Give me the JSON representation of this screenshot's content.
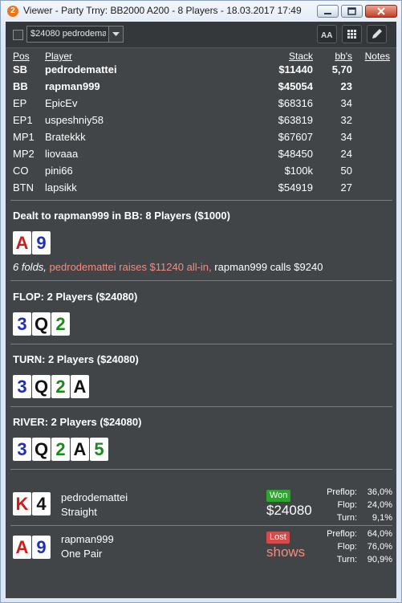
{
  "window": {
    "title": "Viewer - Party Trny: BB2000 A200 - 8 Players - 18.03.2017 17:49",
    "app_icon_label": "2"
  },
  "toolbar": {
    "hand_selector_value": "$24080 pedrodema",
    "font_button_label": "AA"
  },
  "players": {
    "headers": {
      "pos": "Pos",
      "player": "Player",
      "stack": "Stack",
      "bbs": "bb's",
      "notes": "Notes"
    },
    "rows": [
      {
        "pos": "SB",
        "player": "pedrodemattei",
        "stack": "$11440",
        "bbs": "5,70"
      },
      {
        "pos": "BB",
        "player": "rapman999",
        "stack": "$45054",
        "bbs": "23"
      },
      {
        "pos": "EP",
        "player": "EpicEv",
        "stack": "$68316",
        "bbs": "34"
      },
      {
        "pos": "EP1",
        "player": "uspeshniy58",
        "stack": "$63819",
        "bbs": "32"
      },
      {
        "pos": "MP1",
        "player": "Bratekkk",
        "stack": "$67607",
        "bbs": "34"
      },
      {
        "pos": "MP2",
        "player": "liovaaa",
        "stack": "$48450",
        "bbs": "24"
      },
      {
        "pos": "CO",
        "player": "pini66",
        "stack": "$100k",
        "bbs": "50"
      },
      {
        "pos": "BTN",
        "player": "lapsikk",
        "stack": "$54919",
        "bbs": "27"
      }
    ]
  },
  "preflop": {
    "heading": "Dealt to rapman999 in BB: 8 Players ($1000)",
    "hole_cards": [
      {
        "rank": "A",
        "suit": "h"
      },
      {
        "rank": "9",
        "suit": "d"
      }
    ],
    "action_folds": "6 folds,",
    "action_raise": "pedrodemattei raises $11240 all-in,",
    "action_call": "rapman999 calls $9240"
  },
  "flop": {
    "heading": "FLOP: 2 Players ($24080)",
    "cards": [
      {
        "rank": "3",
        "suit": "d"
      },
      {
        "rank": "Q",
        "suit": "s"
      },
      {
        "rank": "2",
        "suit": "c"
      }
    ]
  },
  "turn": {
    "heading": "TURN: 2 Players ($24080)",
    "cards": [
      {
        "rank": "3",
        "suit": "d"
      },
      {
        "rank": "Q",
        "suit": "s"
      },
      {
        "rank": "2",
        "suit": "c"
      },
      {
        "rank": "A",
        "suit": "s"
      }
    ]
  },
  "river": {
    "heading": "RIVER: 2 Players ($24080)",
    "cards": [
      {
        "rank": "3",
        "suit": "d"
      },
      {
        "rank": "Q",
        "suit": "s"
      },
      {
        "rank": "2",
        "suit": "c"
      },
      {
        "rank": "A",
        "suit": "s"
      },
      {
        "rank": "5",
        "suit": "c"
      }
    ]
  },
  "results": [
    {
      "player": "pedrodemattei",
      "hand": "Straight",
      "cards": [
        {
          "rank": "K",
          "suit": "h"
        },
        {
          "rank": "4",
          "suit": "s"
        }
      ],
      "badge": "Won",
      "amount": "$24080",
      "equity": {
        "preflop_label": "Preflop:",
        "preflop": "36,0%",
        "flop_label": "Flop:",
        "flop": "24,0%",
        "turn_label": "Turn:",
        "turn": "9,1%"
      }
    },
    {
      "player": "rapman999",
      "hand": "One Pair",
      "cards": [
        {
          "rank": "A",
          "suit": "h"
        },
        {
          "rank": "9",
          "suit": "d"
        }
      ],
      "badge": "Lost",
      "amount": "shows",
      "equity": {
        "preflop_label": "Preflop:",
        "preflop": "64,0%",
        "flop_label": "Flop:",
        "flop": "76,0%",
        "turn_label": "Turn:",
        "turn": "90,9%"
      }
    }
  ],
  "colors": {
    "hearts": "#d01b1b",
    "spades": "#111111",
    "clubs": "#1a8a1a",
    "diamonds": "#1e2fb8",
    "won": "#2ea52e",
    "lost": "#d44b4b",
    "panel": "#414548"
  }
}
